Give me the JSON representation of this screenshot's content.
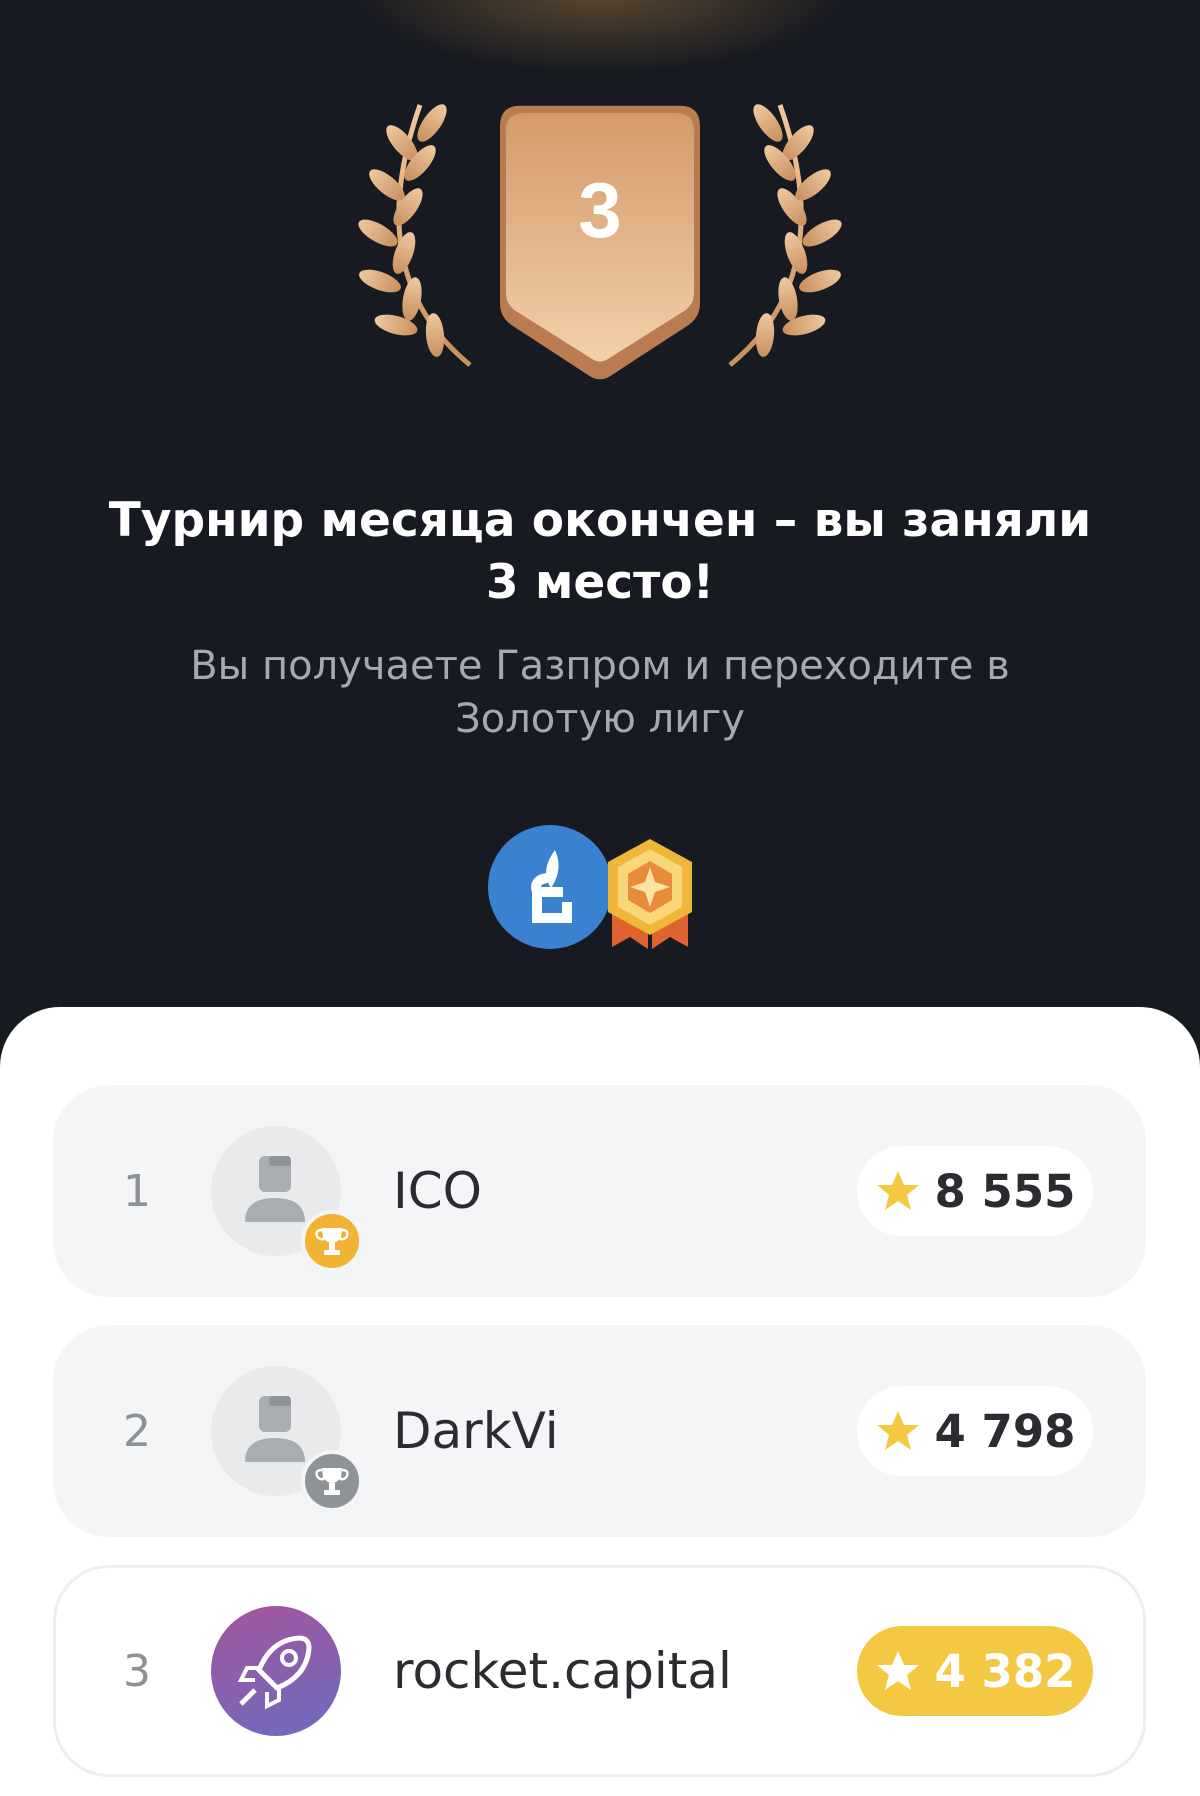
{
  "award": {
    "place": "3"
  },
  "result": {
    "title_line1": "Турнир месяца окончен – вы заняли",
    "title_line2": "3 место!",
    "subtitle_line1": "Вы получаете Газпром и переходите в",
    "subtitle_line2": "Золотую лигу"
  },
  "rewards": [
    {
      "icon": "gazprom-logo-icon",
      "color": "#3a82d0"
    },
    {
      "icon": "gold-league-badge-icon",
      "color": "#e8a93a"
    }
  ],
  "leaderboard": [
    {
      "rank": "1",
      "name": "ICO",
      "score": "8 555",
      "trophy": "gold",
      "avatar": "user-placeholder"
    },
    {
      "rank": "2",
      "name": "DarkVi",
      "score": "4 798",
      "trophy": "silver",
      "avatar": "user-placeholder"
    },
    {
      "rank": "3",
      "name": "rocket.capital",
      "score": "4 382",
      "current_user": true,
      "avatar": "rocket-icon"
    }
  ],
  "colors": {
    "background": "#171a21",
    "award_bronze": "#e0a979",
    "star": "#f5c843",
    "trophy_gold": "#f2b233",
    "trophy_silver": "#8f9297"
  }
}
